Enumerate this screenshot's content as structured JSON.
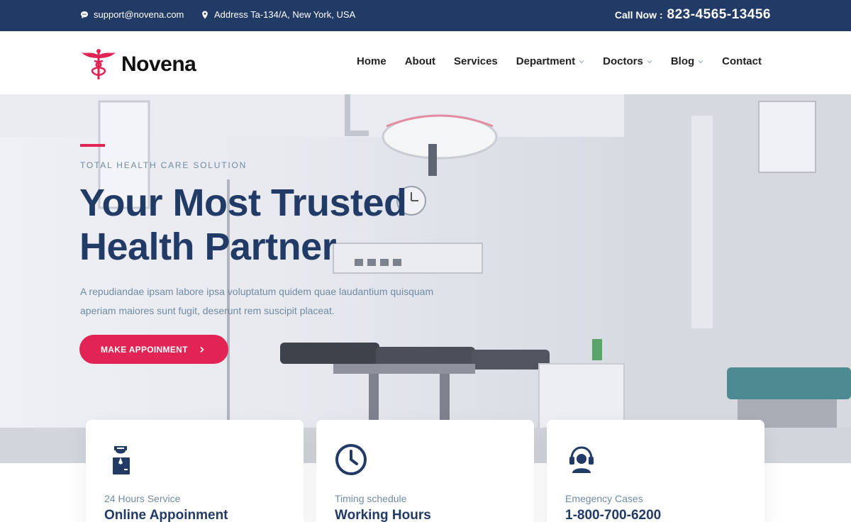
{
  "topbar": {
    "email": "support@novena.com",
    "address": "Address Ta-134/A, New York, USA",
    "call_label": "Call Now :",
    "call_number": "823-4565-13456",
    "icons": {
      "email": "chat-bubble-icon",
      "address": "map-marker-icon"
    }
  },
  "header": {
    "logo_text": "Novena",
    "logo_icon": "caduceus-icon",
    "nav": [
      {
        "label": "Home",
        "dropdown": false
      },
      {
        "label": "About",
        "dropdown": false
      },
      {
        "label": "Services",
        "dropdown": false
      },
      {
        "label": "Department",
        "dropdown": true
      },
      {
        "label": "Doctors",
        "dropdown": true
      },
      {
        "label": "Blog",
        "dropdown": true
      },
      {
        "label": "Contact",
        "dropdown": false
      }
    ]
  },
  "hero": {
    "subtitle": "TOTAL HEALTH CARE SOLUTION",
    "title": "Your Most Trusted Health Partner",
    "description": "A repudiandae ipsam labore ipsa voluptatum quidem quae laudantium quisquam aperiam maiores sunt fugit, deserunt rem suscipit placeat.",
    "cta_label": "MAKE APPOINMENT"
  },
  "features": [
    {
      "label": "24 Hours Service",
      "title": "Online Appoinment",
      "icon": "doctor-icon"
    },
    {
      "label": "Timing schedule",
      "title": "Working Hours",
      "icon": "clock-icon"
    },
    {
      "label": "Emegency Cases",
      "title": "1-800-700-6200",
      "icon": "headset-icon"
    }
  ],
  "colors": {
    "navy": "#223a66",
    "accent": "#e12454",
    "muted": "#6f8ba4"
  }
}
